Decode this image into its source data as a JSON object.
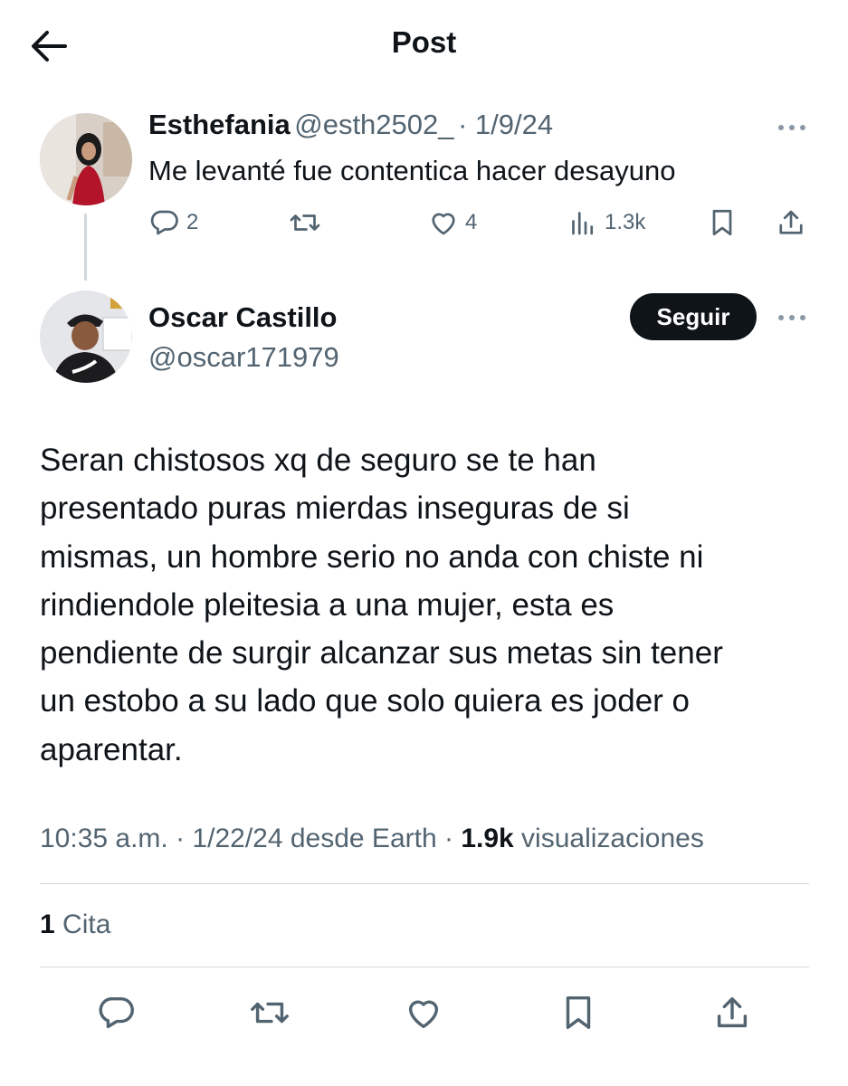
{
  "header": {
    "title": "Post"
  },
  "reply": {
    "name": "Esthefania",
    "handle": "@esth2502_",
    "date": "· 1/9/24",
    "text": "Me levanté fue contentica hacer desayuno",
    "replies": "2",
    "likes": "4",
    "views": "1.3k"
  },
  "post": {
    "name": "Oscar Castillo",
    "handle": "@oscar171979",
    "follow_label": "Seguir",
    "text": "Seran chistosos xq de seguro se te han\npresentado puras mierdas inseguras de si\nmismas, un hombre serio no anda con chiste  ni\nrindiendole pleitesia a una mujer, esta es\npendiente de surgir alcanzar sus metas sin tener\nun estobo a su lado que solo quiera es joder o\naparentar.",
    "time": "10:35 a.m.",
    "date_source": "· 1/22/24 desde Earth ·",
    "views": "1.9k",
    "views_label": "visualizaciones",
    "quotes_count": "1",
    "quotes_label": "Cita"
  },
  "colors": {
    "text": "#0f1419",
    "muted": "#536471",
    "divider": "#cfd9de",
    "button": "#0f1419"
  },
  "icons": [
    "back-arrow-icon",
    "reply-icon",
    "retweet-icon",
    "like-icon",
    "views-icon",
    "bookmark-icon",
    "share-icon",
    "more-icon"
  ]
}
